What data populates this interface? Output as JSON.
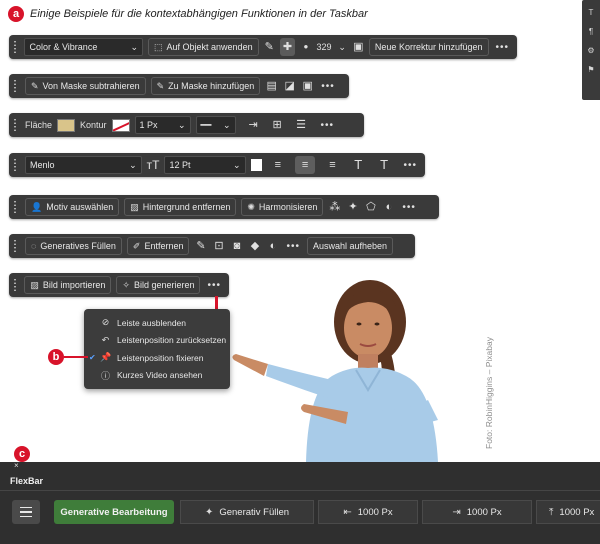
{
  "heading": {
    "marker_a": "a",
    "text": "Einige Beispiele für die kontextabhängigen Funktionen in der Taskbar"
  },
  "bar1": {
    "dropdown": "Color & Vibrance",
    "apply_button": "Auf Objekt anwenden",
    "brush_size": "329",
    "new_correction_button": "Neue Korrektur hinzufügen",
    "more": "•••"
  },
  "bar2": {
    "subtract_button": "Von Maske subtrahieren",
    "add_button": "Zu Maske hinzufügen",
    "more": "•••"
  },
  "bar3": {
    "fill_label": "Fläche",
    "stroke_label": "Kontur",
    "stroke_width": "1 Px",
    "fill_color": "#d9c48a",
    "more": "•••"
  },
  "bar4": {
    "font_family": "Menlo",
    "font_size": "12 Pt",
    "more": "•••"
  },
  "bar5": {
    "select_subject": "Motiv auswählen",
    "remove_background": "Hintergrund entfernen",
    "harmonize": "Harmonisieren",
    "more": "•••"
  },
  "bar6": {
    "generative_fill": "Generatives Füllen",
    "remove": "Entfernen",
    "deselect": "Auswahl aufheben",
    "more": "•••"
  },
  "bar7": {
    "import_image": "Bild importieren",
    "generate_image": "Bild generieren",
    "more": "•••"
  },
  "context_menu": {
    "items": [
      {
        "label": "Leiste ausblenden",
        "icon": "eye-slash-icon"
      },
      {
        "label": "Leistenposition zurücksetzen",
        "icon": "reset-icon"
      },
      {
        "label": "Leistenposition fixieren",
        "icon": "pin-icon",
        "checked": true
      },
      {
        "label": "Kurzes Video ansehen",
        "icon": "info-icon"
      }
    ]
  },
  "marker_b": "b",
  "marker_c": "c",
  "photo_credit": "Foto: RobinHiggins – Pixabay",
  "flexbar": {
    "title": "FlexBar",
    "close": "×",
    "generative_edit": "Generative Bearbeitung",
    "generative_fill": "Generativ Füllen",
    "value1": "1000 Px",
    "value2": "1000 Px",
    "value3": "1000 Px",
    "accent_color": "#3f7d3a"
  },
  "colors": {
    "marker_red": "#d8132a",
    "bar_bg": "#3a3a3a"
  }
}
